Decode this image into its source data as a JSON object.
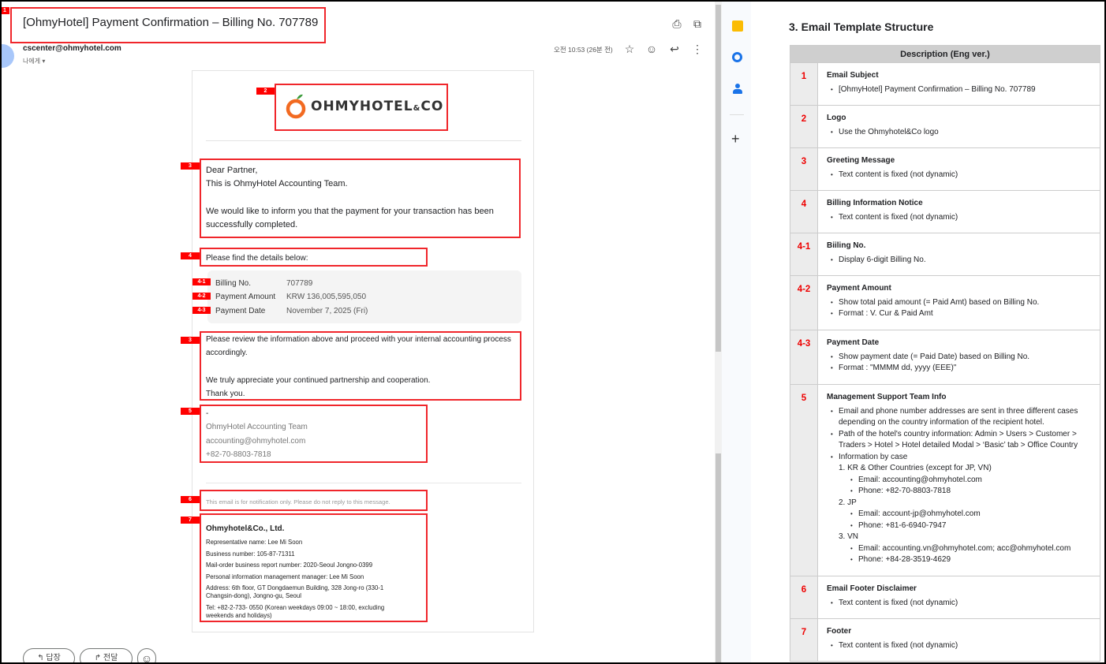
{
  "email": {
    "subject": "[OhmyHotel] Payment Confirmation – Billing No. 707789",
    "sender": "cscenter@ohmyhotel.com",
    "to_me": "나에게",
    "time": "오전 10:53 (26분 전)",
    "logo_text": "OHMYHOTEL&CO",
    "greeting": [
      "Dear Partner,",
      "This is OhmyHotel Accounting Team.",
      "We would like to inform you that the payment for your transaction has been successfully completed."
    ],
    "details_intro": "Please find the details below:",
    "details": [
      {
        "tag": "4-1",
        "label": "Billing No.",
        "value": "707789"
      },
      {
        "tag": "4-2",
        "label": "Payment Amount",
        "value": "KRW 136,005,595,050"
      },
      {
        "tag": "4-3",
        "label": "Payment Date",
        "value": "November 7, 2025 (Fri)"
      }
    ],
    "closing": [
      "Please review the information above and proceed with your internal accounting process accordingly.",
      "We truly appreciate your continued partnership and cooperation.",
      "Thank you."
    ],
    "signature": [
      "-",
      "OhmyHotel Accounting Team",
      "accounting@ohmyhotel.com",
      "+82-70-8803-7818"
    ],
    "disclaimer": "This email is for notification only. Please do not reply to this message.",
    "footer": {
      "company": "Ohmyhotel&Co., Ltd.",
      "lines": [
        "Representative name: Lee Mi Soon",
        "Business number: 105-87-71311",
        "Mail-order business report number: 2020-Seoul Jongno-0399",
        "Personal information management manager: Lee Mi Soon",
        "Address: 6th floor, GT Dongdaemun Building, 328 Jong-ro (330-1 Changsin-dong), Jongno-gu, Seoul",
        "Tel: +82-2-733- 0550 (Korean weekdays 09:00 ~ 18:00, excluding weekends and holidays)"
      ]
    },
    "reply_label": "답장",
    "forward_label": "전달"
  },
  "annotations": [
    "1",
    "2",
    "3",
    "4",
    "4-1",
    "4-2",
    "4-3",
    "3",
    "5",
    "6",
    "7"
  ],
  "doc": {
    "title": "3. Email Template Structure",
    "header": "Description (Eng ver.)",
    "rows": [
      {
        "n": "1",
        "title": "Email Subject",
        "items": [
          "[OhmyHotel] Payment Confirmation – Billing No. 707789"
        ]
      },
      {
        "n": "2",
        "title": "Logo",
        "items": [
          "Use the Ohmyhotel&Co logo"
        ]
      },
      {
        "n": "3",
        "title": "Greeting Message",
        "items": [
          "Text content is fixed (not dynamic)"
        ]
      },
      {
        "n": "4",
        "title": "Billing Information Notice",
        "items": [
          "Text content is fixed (not dynamic)"
        ]
      },
      {
        "n": "4-1",
        "title": "Biiling No.",
        "items": [
          "Display 6-digit Billing No."
        ]
      },
      {
        "n": "4-2",
        "title": "Payment Amount",
        "items": [
          "Show total paid amount (= Paid Amt) based on Billing No.",
          "Format : V. Cur & Paid Amt"
        ]
      },
      {
        "n": "4-3",
        "title": "Payment Date",
        "items": [
          "Show payment date (= Paid Date) based on Billing No.",
          "Format : \"MMMM dd, yyyy (EEE)\""
        ]
      },
      {
        "n": "5",
        "title": "Management Support Team Info",
        "items": [
          "Email and phone number addresses are sent in three different cases depending on the country information of the recipient hotel.",
          "Path of the hotel's country information: Admin > Users > Customer > Traders > Hotel > Hotel detailed Modal > ‘Basic’ tab > Office Country",
          "Information by case"
        ],
        "cases": [
          {
            "name": "1. KR & Other Countries (except for JP, VN)",
            "items": [
              "Email: accounting@ohmyhotel.com",
              "Phone: +82-70-8803-7818"
            ]
          },
          {
            "name": "2. JP",
            "items": [
              "Email: account-jp@ohmyhotel.com",
              "Phone: +81-6-6940-7947"
            ]
          },
          {
            "name": "3. VN",
            "items": [
              "Email: accounting.vn@ohmyhotel.com; acc@ohmyhotel.com",
              "Phone: +84-28-3519-4629"
            ]
          }
        ]
      },
      {
        "n": "6",
        "title": "Email Footer Disclaimer",
        "items": [
          "Text content is fixed (not dynamic)"
        ]
      },
      {
        "n": "7",
        "title": "Footer",
        "items": [
          "Text content is fixed (not dynamic)"
        ]
      }
    ]
  },
  "colors": {
    "annotation": "#f0262b",
    "logo_orange": "#f26a21",
    "doc_number": "#e00000"
  }
}
